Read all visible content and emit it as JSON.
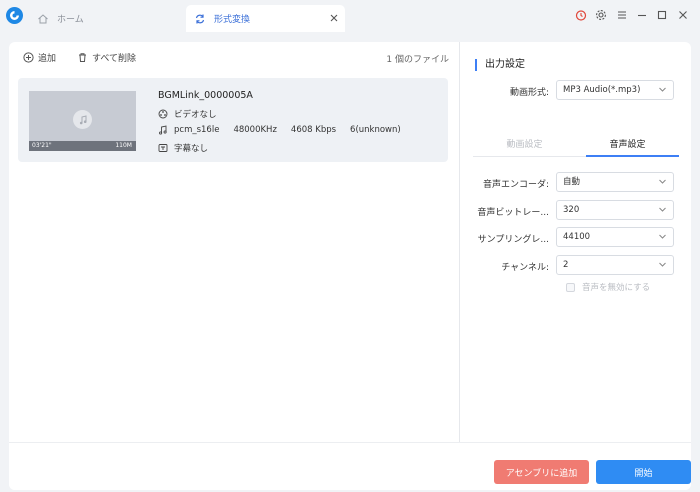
{
  "titlebar": {
    "tabs": [
      {
        "label": "ホーム",
        "icon": "home-icon"
      },
      {
        "label": "形式変換",
        "icon": "convert-icon"
      }
    ],
    "window_controls": [
      "timer-icon",
      "gear-icon",
      "menu-icon",
      "minimize-icon",
      "maximize-icon",
      "close-icon"
    ]
  },
  "toolbar": {
    "add_label": "追加",
    "delete_all_label": "すべて削除",
    "file_count": "1 個のファイル"
  },
  "file": {
    "name": "BGMLink_0000005A",
    "duration": "03'21\"",
    "size": "110M",
    "video": "ビデオなし",
    "audio_codec": "pcm_s16le",
    "sample_rate": "48000KHz",
    "bitrate": "4608 Kbps",
    "channels": "6(unknown)",
    "subtitle": "字幕なし"
  },
  "settings": {
    "title": "出力設定",
    "format_label": "動画形式:",
    "format_value": "MP3 Audio(*.mp3)",
    "tab_video": "動画設定",
    "tab_audio": "音声設定",
    "encoder_label": "音声エンコーダ:",
    "encoder_value": "自動",
    "bitrate_label": "音声ビットレー...",
    "bitrate_value": "320",
    "sampling_label": "サンプリングレ...",
    "sampling_value": "44100",
    "channel_label": "チャンネル:",
    "channel_value": "2",
    "disable_audio_label": "音声を無効にする"
  },
  "footer": {
    "add_to_assembly": "アセンブリに追加",
    "start": "開始"
  },
  "colors": {
    "accent": "#3d7ff5",
    "add_button": "#f07b72",
    "start_button": "#2f8cf3"
  }
}
